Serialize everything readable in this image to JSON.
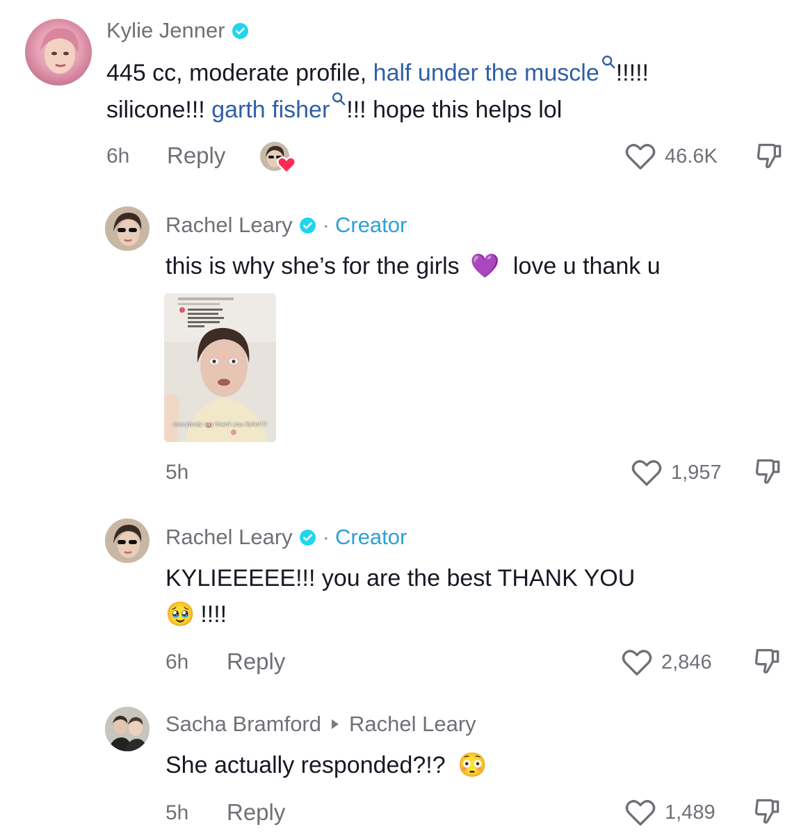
{
  "comments": [
    {
      "author": "Kylie Jenner",
      "text_parts": [
        "445 cc, moderate profile, ",
        "half under the muscle",
        "!!!!!",
        "silicone!!! ",
        "garth fisher",
        "!!! hope this helps lol"
      ],
      "time": "6h",
      "reply_label": "Reply",
      "likes": "46.6K"
    },
    {
      "author": "Rachel Leary",
      "badge": "Creator",
      "dot": "·",
      "text_before": "this is why she’s for the girls",
      "emoji": "💜",
      "text_after": "love u thank u",
      "thumbnail_caption": "everybody say thank you Kylie!!!!",
      "time": "5h",
      "likes": "1,957"
    },
    {
      "author": "Rachel Leary",
      "badge": "Creator",
      "dot": "·",
      "text_line1": "KYLIEEEEE!!! you are the best THANK YOU",
      "emoji": "🥹",
      "text_line2": "!!!!",
      "time": "6h",
      "reply_label": "Reply",
      "likes": "2,846"
    },
    {
      "author": "Sacha Bramford",
      "reply_to": "Rachel Leary",
      "text": "She actually responded?!?",
      "emoji": "😳",
      "time": "5h",
      "reply_label": "Reply",
      "likes": "1,489"
    }
  ],
  "colors": {
    "link": "#2f5fa5",
    "creator": "#2d9fd6",
    "muted": "#6f7077",
    "text": "#161823"
  },
  "icons": [
    "verified-badge-icon",
    "search-icon",
    "heart-outline-icon",
    "dislike-icon",
    "heart-filled-icon",
    "reply-arrow-icon"
  ]
}
